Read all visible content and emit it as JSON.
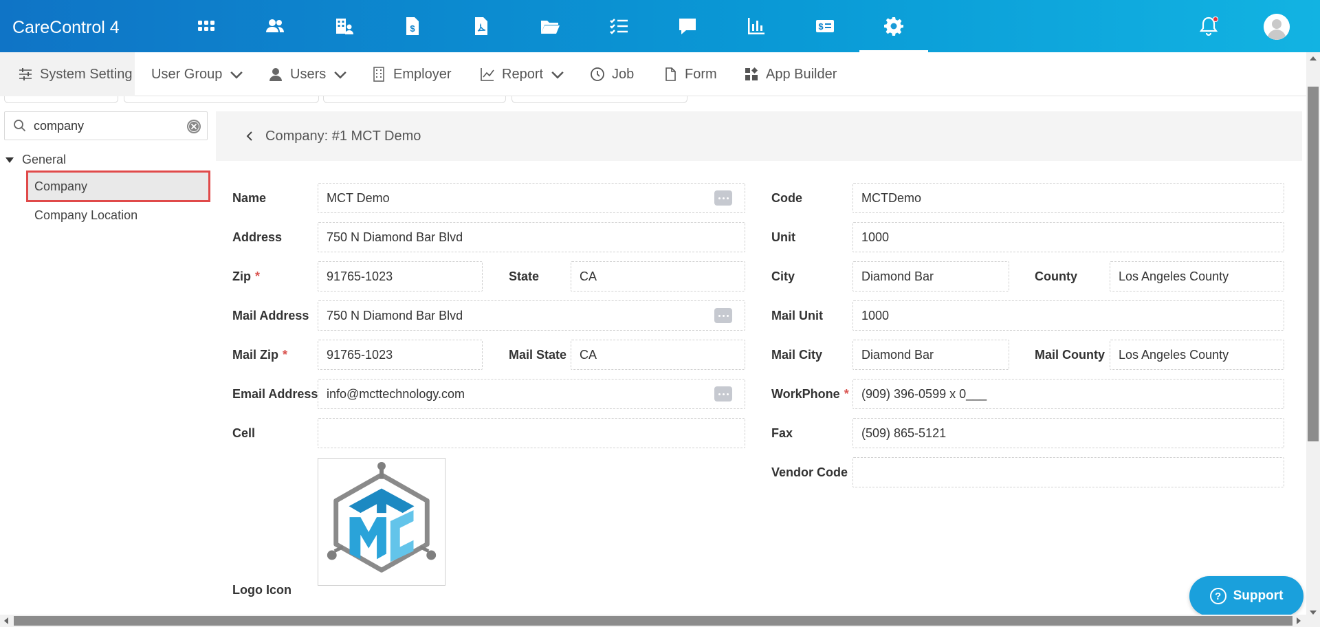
{
  "app": {
    "title": "CareControl 4"
  },
  "topnav": {
    "icons": [
      "apps-icon",
      "people-icon",
      "building-icon",
      "invoice-icon",
      "document-icon",
      "folder-icon",
      "checklist-icon",
      "chat-icon",
      "chart-icon",
      "billing-icon",
      "settings-icon"
    ],
    "active": "settings-icon"
  },
  "subnav": {
    "items": [
      {
        "label": "System Setting",
        "icon": "sliders-icon"
      },
      {
        "label": "User Group",
        "dropdown": true
      },
      {
        "label": "Users",
        "icon": "user-icon",
        "dropdown": true
      },
      {
        "label": "Employer",
        "icon": "building-icon"
      },
      {
        "label": "Report",
        "icon": "line-chart-icon",
        "dropdown": true
      },
      {
        "label": "Job",
        "icon": "clock-icon"
      },
      {
        "label": "Form",
        "icon": "file-icon"
      },
      {
        "label": "App Builder",
        "icon": "widgets-icon"
      }
    ]
  },
  "sidebar": {
    "search_value": "company",
    "group": "General",
    "items": [
      {
        "label": "Company",
        "selected": true
      },
      {
        "label": "Company Location",
        "selected": false
      }
    ]
  },
  "detail": {
    "title": "Company: #1 MCT Demo"
  },
  "form": {
    "left": {
      "name_label": "Name",
      "name_value": "MCT Demo",
      "address_label": "Address",
      "address_value": "750 N Diamond Bar Blvd",
      "zip_label": "Zip",
      "zip_value": "91765-1023",
      "state_label": "State",
      "state_value": "CA",
      "mail_address_label": "Mail Address",
      "mail_address_value": "750 N Diamond Bar Blvd",
      "mail_zip_label": "Mail Zip",
      "mail_zip_value": "91765-1023",
      "mail_state_label": "Mail State",
      "mail_state_value": "CA",
      "email_label": "Email Address",
      "email_value": "info@mcttechnology.com",
      "cell_label": "Cell",
      "cell_value": "",
      "logo_label": "Logo Icon"
    },
    "right": {
      "code_label": "Code",
      "code_value": "MCTDemo",
      "unit_label": "Unit",
      "unit_value": "1000",
      "city_label": "City",
      "city_value": "Diamond Bar",
      "county_label": "County",
      "county_value": "Los Angeles County",
      "mail_unit_label": "Mail Unit",
      "mail_unit_value": "1000",
      "mail_city_label": "Mail City",
      "mail_city_value": "Diamond Bar",
      "mail_county_label": "Mail County",
      "mail_county_value": "Los Angeles County",
      "workphone_label": "WorkPhone",
      "workphone_value": "(909) 396-0599 x 0___",
      "fax_label": "Fax",
      "fax_value": "(509) 865-5121",
      "vendor_code_label": "Vendor Code",
      "vendor_code_value": ""
    },
    "required_mark": "*"
  },
  "support": {
    "label": "Support"
  },
  "colors": {
    "topbar_start": "#0f74c6",
    "topbar_end": "#12b3e2",
    "required": "#d9534f",
    "selected_border": "#e04a4a",
    "support": "#1aa0dc"
  }
}
